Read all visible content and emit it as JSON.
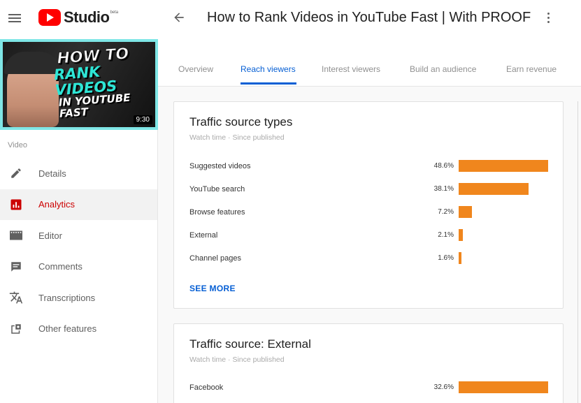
{
  "app": {
    "brand": "Studio",
    "brand_sup": "beta",
    "video_title": "How to Rank Videos in YouTube Fast | With PROOF"
  },
  "thumbnail": {
    "line1": "HOW TO",
    "line2": "RANK VIDEOS",
    "line3": "IN YOUTUBE FAST",
    "duration": "9:30"
  },
  "sidebar": {
    "section_label": "Video",
    "items": [
      {
        "label": "Details",
        "icon": "pencil-icon"
      },
      {
        "label": "Analytics",
        "icon": "analytics-icon",
        "active": true
      },
      {
        "label": "Editor",
        "icon": "film-icon"
      },
      {
        "label": "Comments",
        "icon": "comment-icon"
      },
      {
        "label": "Transcriptions",
        "icon": "translate-icon"
      },
      {
        "label": "Other features",
        "icon": "other-features-icon"
      }
    ]
  },
  "tabs": [
    {
      "label": "Overview",
      "active": false
    },
    {
      "label": "Reach viewers",
      "active": true
    },
    {
      "label": "Interest viewers",
      "active": false
    },
    {
      "label": "Build an audience",
      "active": false
    },
    {
      "label": "Earn revenue",
      "active": false
    }
  ],
  "traffic_types": {
    "title": "Traffic source types",
    "subtitle": "Watch time · Since published",
    "rows": [
      {
        "label": "Suggested videos",
        "value": "48.6%",
        "pct": 48.6
      },
      {
        "label": "YouTube search",
        "value": "38.1%",
        "pct": 38.1
      },
      {
        "label": "Browse features",
        "value": "7.2%",
        "pct": 7.2
      },
      {
        "label": "External",
        "value": "2.1%",
        "pct": 2.1
      },
      {
        "label": "Channel pages",
        "value": "1.6%",
        "pct": 1.6
      }
    ],
    "see_more": "SEE MORE"
  },
  "traffic_external": {
    "title": "Traffic source: External",
    "subtitle": "Watch time · Since published",
    "rows": [
      {
        "label": "Facebook",
        "value": "32.6%",
        "pct": 32.6
      }
    ]
  },
  "colors": {
    "accent": "#065fd4",
    "bar": "#f0861d",
    "active_nav": "#cc0000",
    "brand_red": "#ff0000",
    "thumbnail_border": "#7fe6e6"
  }
}
